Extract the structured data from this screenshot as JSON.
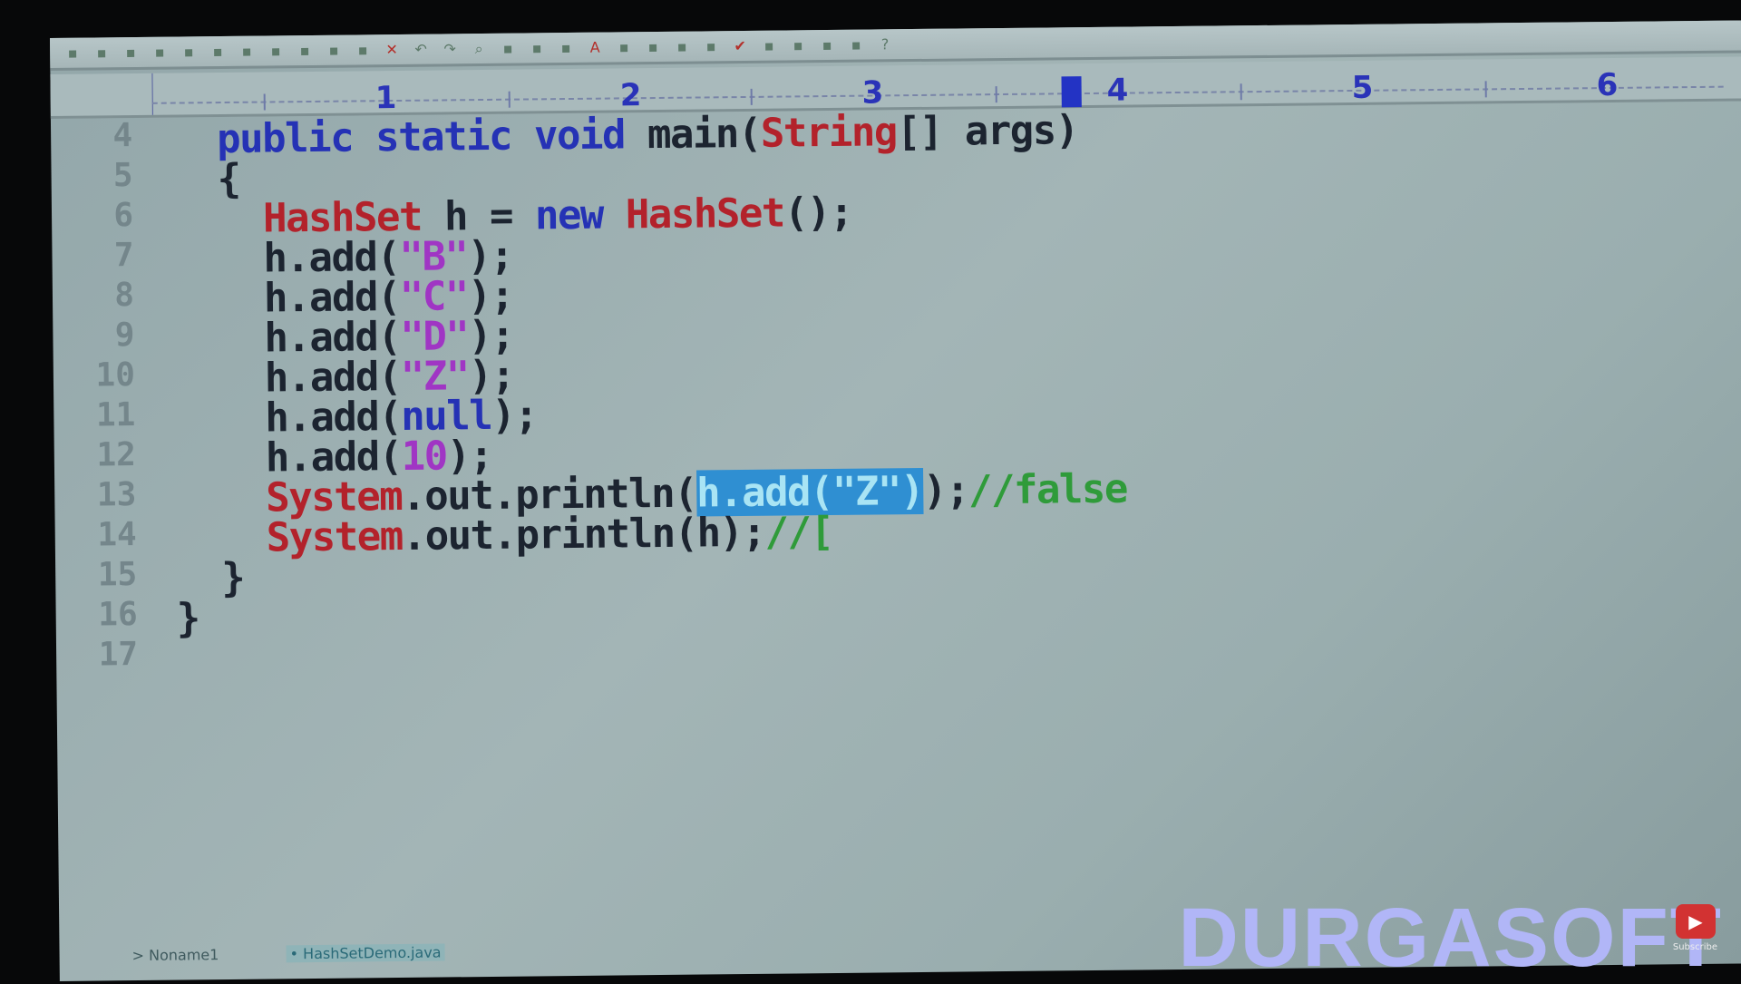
{
  "ruler": {
    "numbers": [
      "1",
      "2",
      "3",
      "4",
      "5",
      "6"
    ]
  },
  "toolbar": {
    "icons": [
      "new-icon",
      "open-icon",
      "save-icon",
      "save-all-icon",
      "save-as-icon",
      "print-icon",
      "print-preview-icon",
      "spellcheck-icon",
      "cut-icon",
      "copy-icon",
      "paste-icon",
      "delete-icon",
      "undo-icon",
      "redo-icon",
      "find-icon",
      "replace-icon",
      "find-next-icon",
      "goto-icon",
      "font-icon",
      "hex-icon",
      "format-icon",
      "column-mode-icon",
      "wrap-icon",
      "check-icon",
      "window-icon",
      "split-icon",
      "tile-icon",
      "run-icon",
      "help-icon"
    ]
  },
  "code": {
    "lines": [
      {
        "n": "4",
        "tokens": [
          [
            "    ",
            ""
          ],
          [
            "public static void",
            "kw"
          ],
          [
            " main(",
            ""
          ],
          [
            "String",
            "cls"
          ],
          [
            "[] args)",
            ""
          ]
        ]
      },
      {
        "n": "5",
        "tokens": [
          [
            "    {",
            ""
          ]
        ]
      },
      {
        "n": "6",
        "tokens": [
          [
            "      ",
            ""
          ],
          [
            "HashSet",
            "cls"
          ],
          [
            " h = ",
            ""
          ],
          [
            "new",
            "kw"
          ],
          [
            " ",
            ""
          ],
          [
            "HashSet",
            "cls"
          ],
          [
            "();",
            ""
          ]
        ]
      },
      {
        "n": "7",
        "tokens": [
          [
            "      h.add(",
            ""
          ],
          [
            "\"B\"",
            "str"
          ],
          [
            ");",
            ""
          ]
        ]
      },
      {
        "n": "8",
        "tokens": [
          [
            "      h.add(",
            ""
          ],
          [
            "\"C\"",
            "str"
          ],
          [
            ");",
            ""
          ]
        ]
      },
      {
        "n": "9",
        "tokens": [
          [
            "      h.add(",
            ""
          ],
          [
            "\"D\"",
            "str"
          ],
          [
            ");",
            ""
          ]
        ]
      },
      {
        "n": "10",
        "tokens": [
          [
            "      h.add(",
            ""
          ],
          [
            "\"Z\"",
            "str"
          ],
          [
            ");",
            ""
          ]
        ]
      },
      {
        "n": "11",
        "tokens": [
          [
            "      h.add(",
            ""
          ],
          [
            "null",
            "kw"
          ],
          [
            ");",
            ""
          ]
        ]
      },
      {
        "n": "12",
        "tokens": [
          [
            "      h.add(",
            ""
          ],
          [
            "10",
            "num"
          ],
          [
            ");",
            ""
          ]
        ]
      },
      {
        "n": "13",
        "tokens": [
          [
            "      ",
            ""
          ],
          [
            "System",
            "cls"
          ],
          [
            ".out.println(",
            ""
          ],
          [
            "h.add(\"Z\")",
            "sel"
          ],
          [
            ");",
            ""
          ],
          [
            "//false",
            "cmt"
          ]
        ]
      },
      {
        "n": "14",
        "tokens": [
          [
            "      ",
            ""
          ],
          [
            "System",
            "cls"
          ],
          [
            ".out.println(h);",
            ""
          ],
          [
            "//[",
            "cmt"
          ]
        ]
      },
      {
        "n": "15",
        "tokens": [
          [
            "    }",
            ""
          ]
        ]
      },
      {
        "n": "16",
        "tokens": [
          [
            "  }",
            ""
          ]
        ]
      },
      {
        "n": "17",
        "tokens": []
      }
    ]
  },
  "tabs": [
    {
      "label": "> Noname1"
    },
    {
      "label": "• HashSetDemo.java"
    }
  ],
  "watermark": "DURGASOFT",
  "youtube": {
    "subscribe_label": "Subscribe"
  },
  "colors": {
    "keyword": "#2532b5",
    "class": "#b3222b",
    "string": "#a035c4",
    "comment": "#2f9b3a",
    "selection": "#2f8fd2"
  }
}
